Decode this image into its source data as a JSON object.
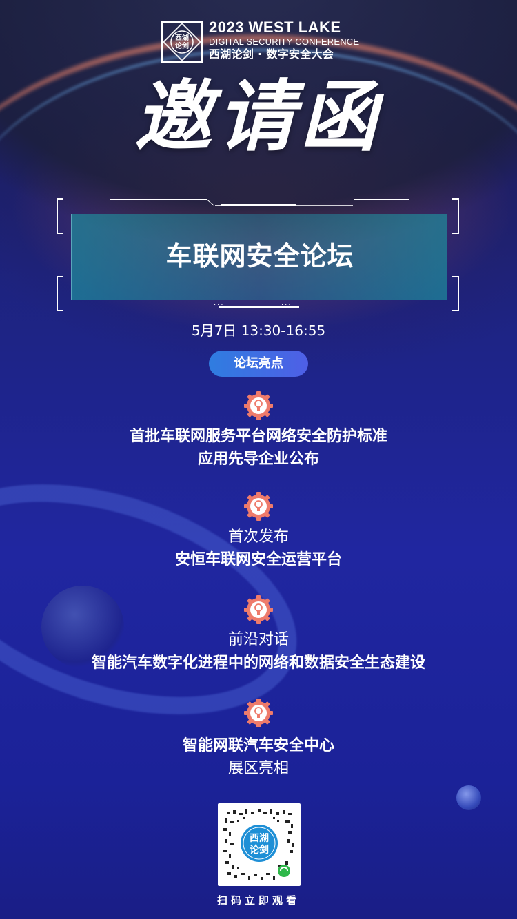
{
  "header": {
    "logo_mark_text": "西湖\n论剑",
    "line1": "2023 WEST LAKE",
    "line2": "DIGITAL SECURITY CONFERENCE",
    "line3": "西湖论剑 · 数字安全大会"
  },
  "title": "邀请函",
  "forum": {
    "name": "车联网安全论坛"
  },
  "datetime": "5月7日 13:30-16:55",
  "highlights_label": "论坛亮点",
  "highlights": [
    {
      "line1": "首批车联网服务平台网络安全防护标准",
      "line2": "应用先导企业公布"
    },
    {
      "line1": "首次发布",
      "line2": "安恒车联网安全运营平台"
    },
    {
      "line1": "前沿对话",
      "line2": "智能汽车数字化进程中的网络和数据安全生态建设"
    },
    {
      "line1": "智能网联汽车安全中心",
      "line2": "展区亮相"
    }
  ],
  "qr": {
    "center_text": "西湖\n论剑",
    "caption": "扫码立即观看"
  },
  "colors": {
    "background": "#1d237e",
    "pill": "#3c6fe3",
    "banner": "#2a8fa0",
    "gear": "#f07a6a"
  }
}
